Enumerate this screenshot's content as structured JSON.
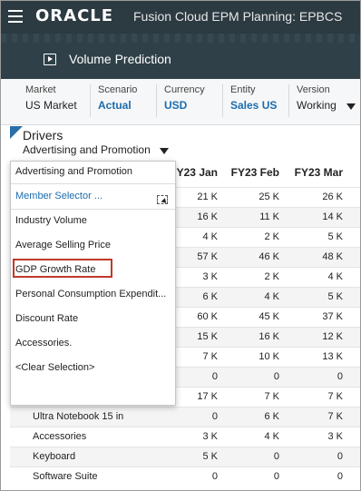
{
  "header": {
    "logo": "ORACLE",
    "app_title": "Fusion Cloud EPM Planning: EPBCS"
  },
  "tab": {
    "label": "Volume Prediction"
  },
  "pov": [
    {
      "label": "Market",
      "value": "US Market",
      "link": false
    },
    {
      "label": "Scenario",
      "value": "Actual",
      "link": true
    },
    {
      "label": "Currency",
      "value": "USD",
      "link": true
    },
    {
      "label": "Entity",
      "value": "Sales US",
      "link": true
    },
    {
      "label": "Version",
      "value": "Working",
      "link": false
    }
  ],
  "drivers": {
    "label": "Drivers",
    "value": "Advertising and Promotion"
  },
  "columns": [
    "FY23 Jan",
    "FY23 Feb",
    "FY23 Mar"
  ],
  "rows": [
    {
      "label": "",
      "values": [
        "21 K",
        "25 K",
        "26 K"
      ]
    },
    {
      "label": "",
      "values": [
        "16 K",
        "11 K",
        "14 K"
      ]
    },
    {
      "label": "",
      "values": [
        "4 K",
        "2 K",
        "5 K"
      ]
    },
    {
      "label": "",
      "values": [
        "57 K",
        "46 K",
        "48 K"
      ]
    },
    {
      "label": "",
      "values": [
        "3 K",
        "2 K",
        "4 K"
      ]
    },
    {
      "label": "",
      "values": [
        "6 K",
        "4 K",
        "5 K"
      ]
    },
    {
      "label": "",
      "values": [
        "60 K",
        "45 K",
        "37 K"
      ]
    },
    {
      "label": "",
      "values": [
        "15 K",
        "16 K",
        "12 K"
      ]
    },
    {
      "label": "",
      "values": [
        "7 K",
        "10 K",
        "13 K"
      ]
    },
    {
      "label": "",
      "values": [
        "0",
        "0",
        "0"
      ]
    },
    {
      "label": "",
      "values": [
        "17 K",
        "7 K",
        "7 K"
      ]
    },
    {
      "label": "Ultra Notebook 15 in",
      "values": [
        "0",
        "6 K",
        "7 K"
      ]
    },
    {
      "label": "Accessories",
      "values": [
        "3 K",
        "4 K",
        "3 K"
      ]
    },
    {
      "label": "Keyboard",
      "values": [
        "5 K",
        "0",
        "0"
      ]
    },
    {
      "label": "Software Suite",
      "values": [
        "0",
        "0",
        "0"
      ]
    }
  ],
  "dropdown": {
    "selected": "Advertising and Promotion",
    "member_selector": "Member Selector ...",
    "options": [
      "Industry Volume",
      "Average Selling Price",
      "GDP Growth Rate",
      "Personal Consumption Expendit...",
      "Discount Rate",
      "Accessories.",
      "<Clear Selection>"
    ],
    "highlighted": "GDP Growth Rate"
  },
  "colors": {
    "header_bg": "#2c3a42",
    "banner_bg": "#2f4048",
    "link": "#1c6cad",
    "highlight": "#c0392b"
  }
}
